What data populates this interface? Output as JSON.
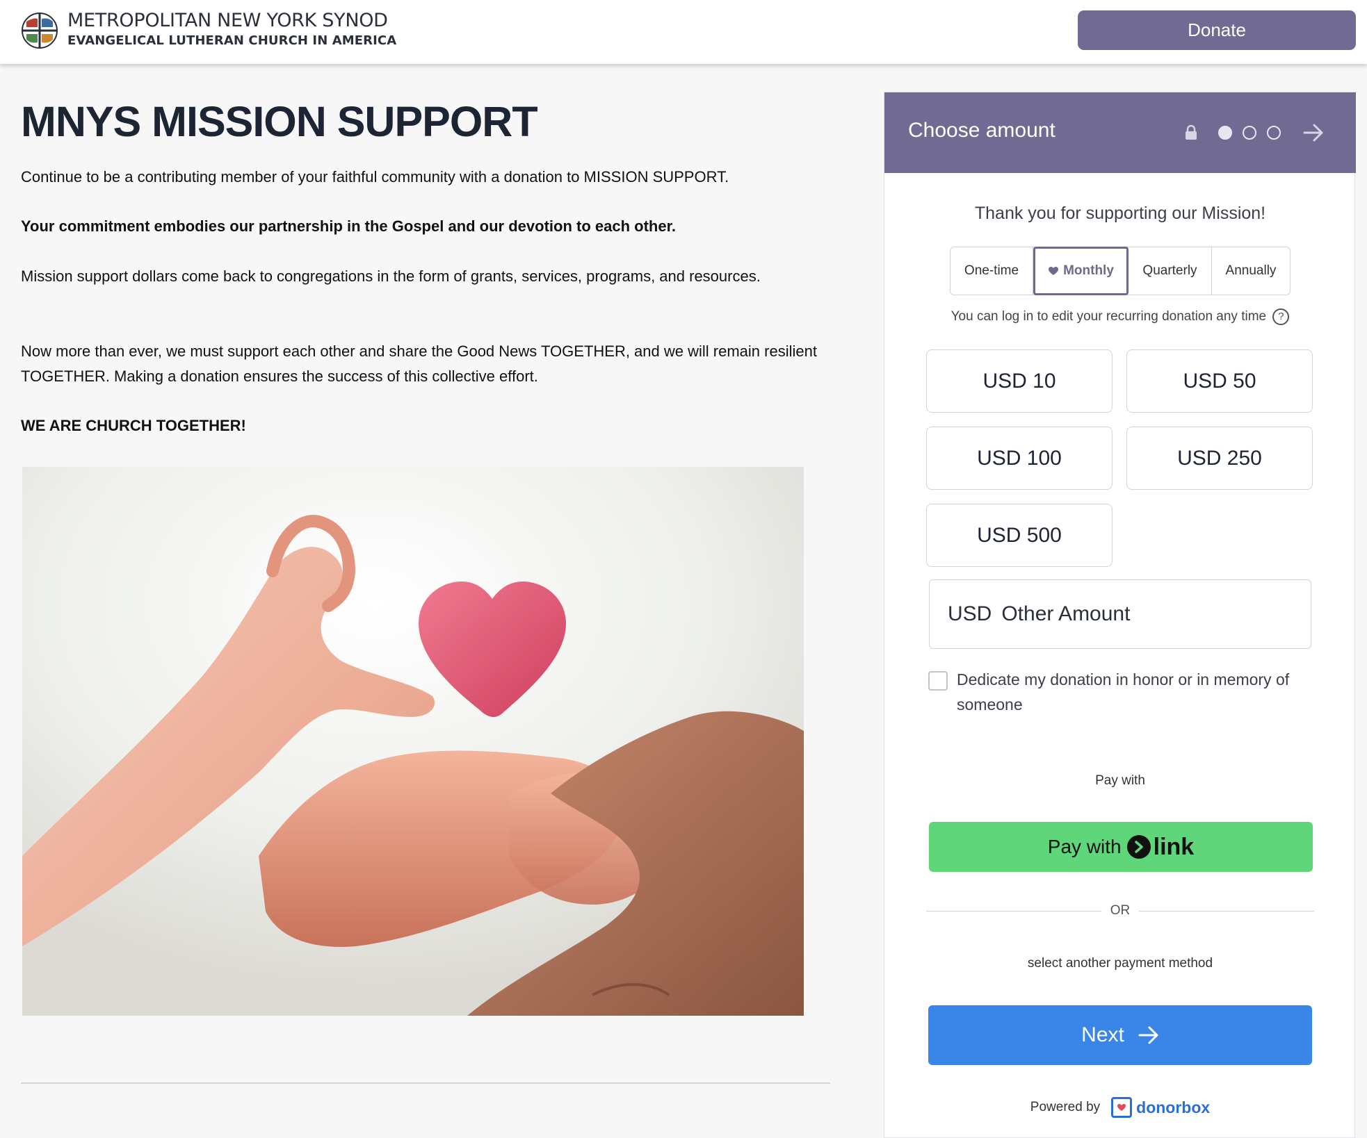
{
  "header": {
    "org_line1": "METROPOLITAN NEW YORK SYNOD",
    "org_line2": "EVANGELICAL LUTHERAN CHURCH IN AMERICA",
    "donate_label": "Donate"
  },
  "main": {
    "title": "MNYS MISSION SUPPORT",
    "paragraphs": [
      "Continue to be a contributing member of your faithful community with a donation to MISSION SUPPORT.",
      "Your commitment embodies our partnership in the Gospel and our devotion to each other.",
      "Mission support dollars come back to congregations in the form of grants, services, programs, and resources.",
      "Now more than ever, we must support each other and share the Good News TOGETHER, and we will remain resilient TOGETHER. Making a donation ensures the success of this collective effort.",
      "WE ARE CHURCH TOGETHER!"
    ]
  },
  "widget": {
    "step_title": "Choose amount",
    "thank_you": "Thank you for supporting our Mission!",
    "frequency": {
      "options": [
        "One-time",
        "Monthly",
        "Quarterly",
        "Annually"
      ],
      "selected": "Monthly"
    },
    "recurring_note": "You can log in to edit your recurring donation any time",
    "help_glyph": "?",
    "amounts": [
      "USD 10",
      "USD 50",
      "USD 100",
      "USD 250",
      "USD 500"
    ],
    "other_currency": "USD",
    "other_placeholder": "Other Amount",
    "dedicate_text": "Dedicate my donation in honor or in memory of someone",
    "pay_with_label": "Pay with",
    "link_button": {
      "prefix": "Pay with",
      "brand": "link"
    },
    "or_text": "OR",
    "another_method": "select another payment method",
    "next_label": "Next",
    "powered_by": "Powered by",
    "powered_brand": "donorbox"
  },
  "colors": {
    "brand_purple": "#716a92",
    "link_green": "#5fd67a",
    "next_blue": "#3a86e8",
    "donorbox_blue": "#2a6fd6"
  }
}
